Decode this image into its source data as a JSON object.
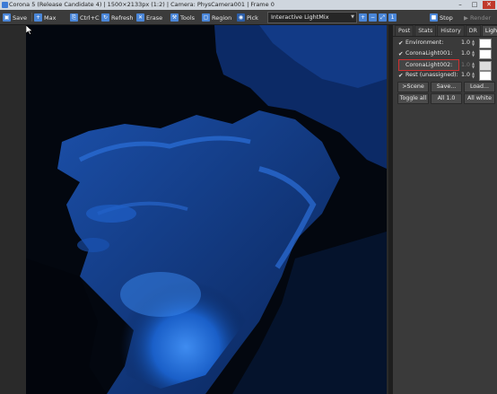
{
  "window": {
    "title": "Corona 5 (Release Candidate 4) | 1500×2133px (1:2) | Camera: PhysCamera001 | Frame 0",
    "minimize": "–",
    "maximize": "□",
    "close": "✕"
  },
  "toolbar": {
    "save": "Save",
    "max": "Max",
    "ctrl_c": "Ctrl+C",
    "refresh": "Refresh",
    "erase": "Erase",
    "tools": "Tools",
    "region": "Region",
    "pick": "Pick",
    "render_element": "Interactive LightMix",
    "stop": "Stop",
    "render": "Render"
  },
  "panel": {
    "tabs": [
      "Post",
      "Stats",
      "History",
      "DR",
      "LightMix"
    ],
    "active_tab": "LightMix",
    "lights": [
      {
        "label": "Environment:",
        "checked": true,
        "value": "1.0"
      },
      {
        "label": "CoronaLight001:",
        "checked": true,
        "value": "1.0"
      },
      {
        "label": "CoronaLight002:",
        "checked": false,
        "value": "1.0",
        "selected": true
      },
      {
        "label": "Rest (unassigned):",
        "checked": true,
        "value": "1.0"
      }
    ],
    "buttons_row1": [
      ">Scene",
      "Save...",
      "Load..."
    ],
    "buttons_row2": [
      "Toggle all",
      "All 1.0",
      "All white"
    ]
  },
  "colors": {
    "accent": "#4a86d8",
    "highlight_border": "#d03030",
    "render_blue": "#1a5fc8"
  }
}
